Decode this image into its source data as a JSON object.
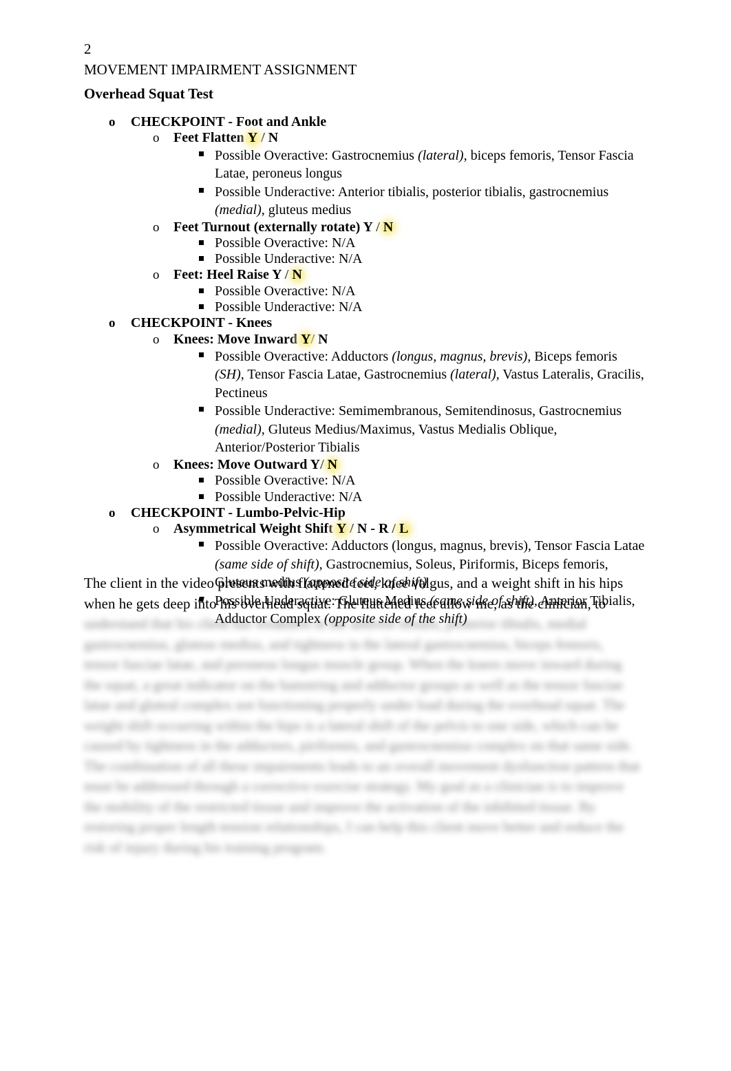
{
  "header": {
    "page_number": "2",
    "document_title": "MOVEMENT IMPAIRMENT ASSIGNMENT"
  },
  "section": {
    "title": "Overhead Squat Test"
  },
  "bullets": {
    "circle": "o",
    "square": "▪"
  },
  "outline": [
    {
      "level": 1,
      "text": "CHECKPOINT - Foot and Ankle"
    },
    {
      "level": 2,
      "pre": "Feet Flatten ",
      "hl1": "Y",
      "mid": " / N",
      "full": "Feet Flatten Y / N"
    },
    {
      "level": 3,
      "label": "Possible Overactive: ",
      "t1": "Gastrocnemius ",
      "i1": "(lateral),",
      "t2": " biceps femoris, Tensor Fascia Latae, peroneus longus"
    },
    {
      "level": 3,
      "label": "Possible Underactive: ",
      "t1": "Anterior tibialis, posterior tibialis, gastrocnemius ",
      "i1": "(medial),",
      "t2": " gluteus medius"
    },
    {
      "level": 2,
      "pre": "Feet Turnout (externally rotate) Y / ",
      "hl1": "N",
      "mid": "",
      "full": "Feet Turnout (externally rotate) Y / N"
    },
    {
      "level": 3,
      "label": "Possible Overactive: ",
      "t1": "N/A",
      "i1": "",
      "t2": ""
    },
    {
      "level": 3,
      "label": "Possible Underactive: ",
      "t1": "N/A",
      "i1": "",
      "t2": ""
    },
    {
      "level": 2,
      "pre": "Feet: Heel Raise Y / ",
      "hl1": "N",
      "mid": "",
      "full": "Feet: Heel Raise Y / N"
    },
    {
      "level": 3,
      "label": "Possible Overactive: ",
      "t1": "N/A",
      "i1": "",
      "t2": ""
    },
    {
      "level": 3,
      "label": "Possible Underactive: ",
      "t1": "N/A",
      "i1": "",
      "t2": ""
    },
    {
      "level": 1,
      "text": "CHECKPOINT - Knees"
    },
    {
      "level": 2,
      "pre": "Knees: Move Inward ",
      "hl1": "Y",
      "mid": "/ N",
      "full": "Knees: Move Inward Y/ N"
    },
    {
      "level": 3,
      "label": "Possible Overactive: ",
      "t1": "Adductors ",
      "i1": "(longus, magnus, brevis),",
      "t2": " Biceps femoris ",
      "i2": "(SH),",
      "t3": " Tensor Fascia Latae, Gastrocnemius ",
      "i3": "(lateral),",
      "t4": " Vastus Lateralis, Gracilis, Pectineus"
    },
    {
      "level": 3,
      "label": "Possible Underactive: ",
      "t1": "Semimembranous, Semitendinosus, Gastrocnemius ",
      "i1": "(medial),",
      "t2": " Gluteus Medius/Maximus, Vastus Medialis Oblique, Anterior/Posterior Tibialis"
    },
    {
      "level": 2,
      "pre": "Knees: Move Outward Y/ ",
      "hl1": "N",
      "mid": "",
      "full": "Knees: Move Outward Y/ N"
    },
    {
      "level": 3,
      "label": "Possible Overactive: ",
      "t1": "N/A",
      "i1": "",
      "t2": ""
    },
    {
      "level": 3,
      "label": "Possible Underactive: ",
      "t1": "N/A",
      "i1": "",
      "t2": ""
    },
    {
      "level": 1,
      "text": "CHECKPOINT - Lumbo-Pelvic-Hip"
    },
    {
      "level": 2,
      "pre": "Asymmetrical Weight Shift ",
      "hl1": "Y",
      "mid": " / N - R / ",
      "hl2": "L",
      "full": "Asymmetrical Weight Shift Y / N - R / L"
    },
    {
      "level": 3,
      "label": "Possible Overactive: ",
      "t1": "Adductors (longus, magnus, brevis), Tensor Fascia Latae ",
      "i1": "(same side of shift),",
      "t2": " Gastrocnemius, Soleus, Piriformis, Biceps femoris, Gluteus medius ",
      "i2": "(opposite side of shift)"
    },
    {
      "level": 3,
      "label": "Possible Underactive: ",
      "t1": "Gluteus Medius ",
      "i1": "(same side of shift),",
      "t2": " Anterior Tibialis, Adductor Complex ",
      "i2": "(opposite side of the shift)"
    }
  ],
  "rows": {
    "r0": {
      "text": "CHECKPOINT - Foot and Ankle"
    },
    "r1": {
      "pre": "Feet Flatten ",
      "hl1": "Y",
      "post": " / N"
    },
    "r2a": {
      "label": "Possible Overactive: Gastrocnemius "
    },
    "r2b": {
      "ital": "(lateral),"
    },
    "r2c": {
      "rest": " biceps femoris, Tensor Fascia Latae, peroneus longus"
    },
    "r3a": {
      "label": "Possible Underactive: Anterior tibialis, posterior tibialis, gastrocnemius "
    },
    "r3b": {
      "ital": "(medial),"
    },
    "r3c": {
      "rest": " gluteus medius"
    },
    "r4": {
      "pre": "Feet Turnout (externally rotate) Y / ",
      "hl1": "N",
      "post": ""
    },
    "r5": {
      "text": "Possible Overactive: N/A"
    },
    "r6": {
      "text": "Possible Underactive: N/A"
    },
    "r7": {
      "pre": "Feet: Heel Raise Y / ",
      "hl1": "N",
      "post": ""
    },
    "r8": {
      "text": "Possible Overactive: N/A"
    },
    "r9": {
      "text": "Possible Underactive: N/A"
    },
    "r10": {
      "text": "CHECKPOINT - Knees"
    },
    "r11": {
      "pre": "Knees: Move Inward ",
      "hl1": "Y",
      "post": "/ N"
    },
    "r12a": {
      "label": "Possible Overactive: Adductors "
    },
    "r12b": {
      "ital": "(longus, magnus, brevis),"
    },
    "r12c": {
      "mid": " Biceps femoris "
    },
    "r12d": {
      "ital2": "(SH),"
    },
    "r12e": {
      "mid2": " Tensor Fascia Latae, Gastrocnemius "
    },
    "r12f": {
      "ital3": "(lateral),"
    },
    "r12g": {
      "rest": " Vastus Lateralis, Gracilis, Pectineus"
    },
    "r13a": {
      "label": "Possible Underactive: Semimembranous, Semitendinosus, Gastrocnemius "
    },
    "r13b": {
      "ital": "(medial),"
    },
    "r13c": {
      "rest": " Gluteus Medius/Maximus, Vastus Medialis Oblique, Anterior/Posterior Tibialis"
    },
    "r14": {
      "pre": "Knees: Move Outward Y/ ",
      "hl1": "N",
      "post": ""
    },
    "r15": {
      "text": "Possible Overactive: N/A"
    },
    "r16": {
      "text": "Possible Underactive: N/A"
    },
    "r17": {
      "text": "CHECKPOINT - Lumbo-Pelvic-Hip"
    },
    "r18": {
      "pre": "Asymmetrical Weight Shift ",
      "hl1": "Y",
      "mid": " / N - R / ",
      "hl2": "L"
    },
    "r19a": {
      "label": "Possible Overactive: Adductors (longus, magnus, brevis), Tensor Fascia Latae "
    },
    "r19b": {
      "ital": "(same side of shift),"
    },
    "r19c": {
      "mid": " Gastrocnemius, Soleus, Piriformis, Biceps femoris, Gluteus medius "
    },
    "r19d": {
      "ital2": "(opposite side of shift)"
    },
    "r20a": {
      "label": "Possible Underactive: Gluteus Medius "
    },
    "r20b": {
      "ital": "(same side of shift),"
    },
    "r20c": {
      "mid": " Anterior Tibialis, Adductor Complex "
    },
    "r20d": {
      "ital2": "(opposite side of the shift)"
    }
  },
  "paragraph": {
    "visible": "The client in the video presents with flattened feet, knee valgus, and a weight shift in his hips when he gets deep into his overhead squat. The flattened feet allow me, as the clinician, to ",
    "redacted": "understand that his client has weakness in the anterior tibialis, posterior tibialis, medial gastrocnemius, gluteus medius, and tightness in the lateral gastrocnemius, biceps femoris, tensor fasciae latae, and peroneus longus muscle group. When the knees move inward during the squat, a great indicator on the hamstring and adductor groups as well as the tensor fasciae latae and gluteal complex not functioning properly under load during the overhead squat. The weight shift occurring within the hips is a lateral shift of the pelvis to one side, which can be caused by tightness in the adductors, piriformis, and gastrocnemius complex on that same side. The combination of all these impairments leads to an overall movement dysfunction pattern that must be addressed through a corrective exercise strategy. My goal as a clinician is to improve the mobility of the restricted tissue and improve the activation of the inhibited tissue. By restoring proper length tension relationships, I can help this client move better and reduce the risk of injury during his training program."
  }
}
